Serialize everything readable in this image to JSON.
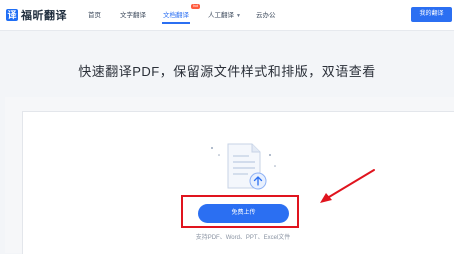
{
  "header": {
    "logo_glyph": "译",
    "logo_text": "福昕翻译",
    "nav": [
      {
        "label": "首页",
        "active": false
      },
      {
        "label": "文字翻译",
        "active": false
      },
      {
        "label": "文档翻译",
        "active": true,
        "badge": "hot"
      },
      {
        "label": "人工翻译",
        "active": false,
        "dropdown": true
      },
      {
        "label": "云办公",
        "active": false
      }
    ],
    "login_label": "我的翻译"
  },
  "main": {
    "headline": "快速翻译PDF，保留源文件样式和排版，双语查看",
    "upload_label": "免费上传",
    "support_text": "支持PDF、Word、PPT、Excel文件"
  },
  "colors": {
    "accent": "#2b6ff2",
    "highlight": "#e0141e"
  },
  "icons": {
    "document": "document-upload-icon",
    "arrow": "red-pointer-arrow"
  }
}
